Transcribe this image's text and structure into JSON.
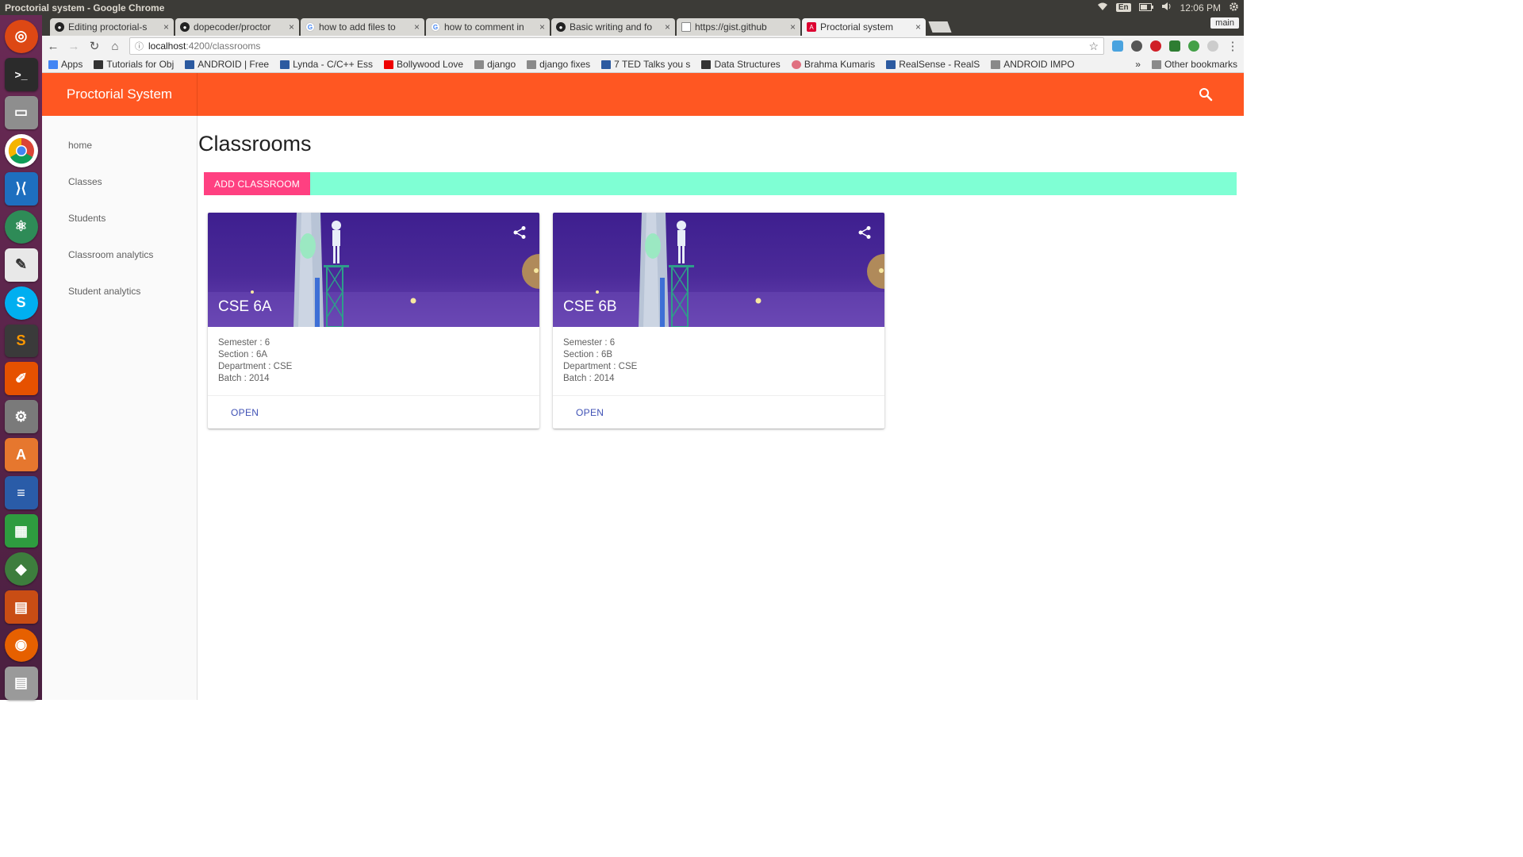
{
  "os": {
    "window_title": "Proctorial system - Google Chrome",
    "input_lang": "En",
    "clock": "12:06 PM"
  },
  "browser": {
    "tabs": [
      {
        "title": "Editing proctorial-s",
        "icon": "github-icon"
      },
      {
        "title": "dopecoder/proctor",
        "icon": "github-icon"
      },
      {
        "title": "how to add files to",
        "icon": "google-icon"
      },
      {
        "title": "how to comment in",
        "icon": "google-icon"
      },
      {
        "title": "Basic writing and fo",
        "icon": "github-icon"
      },
      {
        "title": "https://gist.github",
        "icon": "document-icon"
      },
      {
        "title": "Proctorial system",
        "icon": "angular-icon"
      }
    ],
    "profile": "main",
    "url_host": "localhost",
    "url_path": ":4200/classrooms",
    "bookmarks": [
      "Apps",
      "Tutorials for Obj",
      "ANDROID | Free",
      "Lynda - C/C++ Ess",
      "Bollywood Love",
      "django",
      "django fixes",
      "7 TED Talks you s",
      "Data Structures",
      "Brahma Kumaris",
      "RealSense - RealS",
      "ANDROID IMPO"
    ],
    "bookmarks_overflow": "»",
    "other_bookmarks": "Other bookmarks"
  },
  "app": {
    "brand": "Proctorial System",
    "accent_color": "#ff5722",
    "nav": [
      "home",
      "Classes",
      "Students",
      "Classroom analytics",
      "Student analytics"
    ],
    "page_title": "Classrooms",
    "add_button": "ADD CLASSROOM",
    "classrooms": [
      {
        "name": "CSE 6A",
        "semester": "Semester : 6",
        "section": "Section : 6A",
        "department": "Department : CSE",
        "batch": "Batch : 2014",
        "action": "OPEN"
      },
      {
        "name": "CSE 6B",
        "semester": "Semester : 6",
        "section": "Section : 6B",
        "department": "Department : CSE",
        "batch": "Batch : 2014",
        "action": "OPEN"
      }
    ]
  }
}
